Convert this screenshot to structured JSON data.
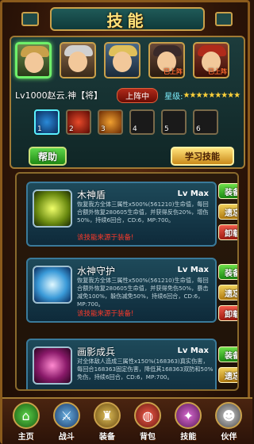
{
  "header": {
    "title": "技能",
    "close_icon": "close-icon"
  },
  "heroes": [
    {
      "name": "hero-zhaoyun",
      "selected": true,
      "tag": ""
    },
    {
      "name": "hero-2",
      "selected": false,
      "tag": ""
    },
    {
      "name": "hero-3",
      "selected": false,
      "tag": ""
    },
    {
      "name": "hero-4",
      "selected": false,
      "tag": "已上阵"
    },
    {
      "name": "hero-5",
      "selected": false,
      "tag": "已上阵"
    }
  ],
  "hero_info": {
    "name": "Lv1000赵云.神【将】",
    "deploy_status": "上阵中",
    "star_label": "星级:",
    "stars": "★★★★★★★★★"
  },
  "skill_slots": [
    {
      "n": "1"
    },
    {
      "n": "2"
    },
    {
      "n": "3"
    },
    {
      "n": "4"
    },
    {
      "n": "5"
    },
    {
      "n": "6"
    }
  ],
  "buttons": {
    "help": "帮助",
    "learn": "学习技能"
  },
  "skills": [
    {
      "name": "木神盾",
      "level": "Lv Max",
      "desc": "恢复我方全体三属性x500%(561210)生命值，每回合额外恢复280605生命值，并获得反伤20%，增伤50%，持续6回合，CD:6，MP:700。",
      "warn": "该技能来源于装备!",
      "equip": "装备",
      "forget": "遗忘",
      "unload": "卸载"
    },
    {
      "name": "水神守护",
      "level": "Lv Max",
      "desc": "恢复我方全体三属性x500%(561210)生命值，每回合额外恢复280605生命值，并获得免伤50%，暴击减免100%，躲伤减免50%，持续6回合，CD:6，MP:700。",
      "warn": "该技能来源于装备!",
      "equip": "装备",
      "forget": "遗忘",
      "unload": "卸载"
    },
    {
      "name": "画影成兵",
      "level": "Lv Max",
      "desc": "对全体敌人造成三属性x150%(168363)真实伤害，每回合168363固定伤害，降低其168363双防和50%免伤，持续6回合，CD:6，MP:700。",
      "warn": "",
      "equip": "装备",
      "forget": "遗忘",
      "unload": ""
    }
  ],
  "bottom_nav": [
    {
      "label": "主页",
      "icon": "home-icon"
    },
    {
      "label": "战斗",
      "icon": "battle-icon"
    },
    {
      "label": "装备",
      "icon": "equipment-icon"
    },
    {
      "label": "背包",
      "icon": "bag-icon"
    },
    {
      "label": "技能",
      "icon": "skill-icon"
    },
    {
      "label": "伙伴",
      "icon": "partner-icon"
    }
  ]
}
